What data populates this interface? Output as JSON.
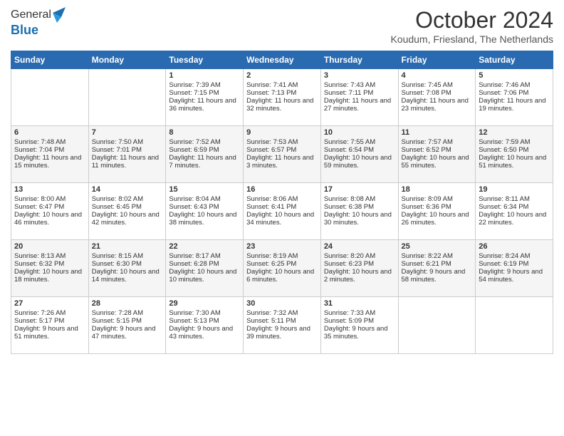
{
  "logo": {
    "line1": "General",
    "line2": "Blue"
  },
  "header": {
    "month": "October 2024",
    "location": "Koudum, Friesland, The Netherlands"
  },
  "weekdays": [
    "Sunday",
    "Monday",
    "Tuesday",
    "Wednesday",
    "Thursday",
    "Friday",
    "Saturday"
  ],
  "weeks": [
    [
      {
        "day": "",
        "sunrise": "",
        "sunset": "",
        "daylight": ""
      },
      {
        "day": "",
        "sunrise": "",
        "sunset": "",
        "daylight": ""
      },
      {
        "day": "1",
        "sunrise": "Sunrise: 7:39 AM",
        "sunset": "Sunset: 7:15 PM",
        "daylight": "Daylight: 11 hours and 36 minutes."
      },
      {
        "day": "2",
        "sunrise": "Sunrise: 7:41 AM",
        "sunset": "Sunset: 7:13 PM",
        "daylight": "Daylight: 11 hours and 32 minutes."
      },
      {
        "day": "3",
        "sunrise": "Sunrise: 7:43 AM",
        "sunset": "Sunset: 7:11 PM",
        "daylight": "Daylight: 11 hours and 27 minutes."
      },
      {
        "day": "4",
        "sunrise": "Sunrise: 7:45 AM",
        "sunset": "Sunset: 7:08 PM",
        "daylight": "Daylight: 11 hours and 23 minutes."
      },
      {
        "day": "5",
        "sunrise": "Sunrise: 7:46 AM",
        "sunset": "Sunset: 7:06 PM",
        "daylight": "Daylight: 11 hours and 19 minutes."
      }
    ],
    [
      {
        "day": "6",
        "sunrise": "Sunrise: 7:48 AM",
        "sunset": "Sunset: 7:04 PM",
        "daylight": "Daylight: 11 hours and 15 minutes."
      },
      {
        "day": "7",
        "sunrise": "Sunrise: 7:50 AM",
        "sunset": "Sunset: 7:01 PM",
        "daylight": "Daylight: 11 hours and 11 minutes."
      },
      {
        "day": "8",
        "sunrise": "Sunrise: 7:52 AM",
        "sunset": "Sunset: 6:59 PM",
        "daylight": "Daylight: 11 hours and 7 minutes."
      },
      {
        "day": "9",
        "sunrise": "Sunrise: 7:53 AM",
        "sunset": "Sunset: 6:57 PM",
        "daylight": "Daylight: 11 hours and 3 minutes."
      },
      {
        "day": "10",
        "sunrise": "Sunrise: 7:55 AM",
        "sunset": "Sunset: 6:54 PM",
        "daylight": "Daylight: 10 hours and 59 minutes."
      },
      {
        "day": "11",
        "sunrise": "Sunrise: 7:57 AM",
        "sunset": "Sunset: 6:52 PM",
        "daylight": "Daylight: 10 hours and 55 minutes."
      },
      {
        "day": "12",
        "sunrise": "Sunrise: 7:59 AM",
        "sunset": "Sunset: 6:50 PM",
        "daylight": "Daylight: 10 hours and 51 minutes."
      }
    ],
    [
      {
        "day": "13",
        "sunrise": "Sunrise: 8:00 AM",
        "sunset": "Sunset: 6:47 PM",
        "daylight": "Daylight: 10 hours and 46 minutes."
      },
      {
        "day": "14",
        "sunrise": "Sunrise: 8:02 AM",
        "sunset": "Sunset: 6:45 PM",
        "daylight": "Daylight: 10 hours and 42 minutes."
      },
      {
        "day": "15",
        "sunrise": "Sunrise: 8:04 AM",
        "sunset": "Sunset: 6:43 PM",
        "daylight": "Daylight: 10 hours and 38 minutes."
      },
      {
        "day": "16",
        "sunrise": "Sunrise: 8:06 AM",
        "sunset": "Sunset: 6:41 PM",
        "daylight": "Daylight: 10 hours and 34 minutes."
      },
      {
        "day": "17",
        "sunrise": "Sunrise: 8:08 AM",
        "sunset": "Sunset: 6:38 PM",
        "daylight": "Daylight: 10 hours and 30 minutes."
      },
      {
        "day": "18",
        "sunrise": "Sunrise: 8:09 AM",
        "sunset": "Sunset: 6:36 PM",
        "daylight": "Daylight: 10 hours and 26 minutes."
      },
      {
        "day": "19",
        "sunrise": "Sunrise: 8:11 AM",
        "sunset": "Sunset: 6:34 PM",
        "daylight": "Daylight: 10 hours and 22 minutes."
      }
    ],
    [
      {
        "day": "20",
        "sunrise": "Sunrise: 8:13 AM",
        "sunset": "Sunset: 6:32 PM",
        "daylight": "Daylight: 10 hours and 18 minutes."
      },
      {
        "day": "21",
        "sunrise": "Sunrise: 8:15 AM",
        "sunset": "Sunset: 6:30 PM",
        "daylight": "Daylight: 10 hours and 14 minutes."
      },
      {
        "day": "22",
        "sunrise": "Sunrise: 8:17 AM",
        "sunset": "Sunset: 6:28 PM",
        "daylight": "Daylight: 10 hours and 10 minutes."
      },
      {
        "day": "23",
        "sunrise": "Sunrise: 8:19 AM",
        "sunset": "Sunset: 6:25 PM",
        "daylight": "Daylight: 10 hours and 6 minutes."
      },
      {
        "day": "24",
        "sunrise": "Sunrise: 8:20 AM",
        "sunset": "Sunset: 6:23 PM",
        "daylight": "Daylight: 10 hours and 2 minutes."
      },
      {
        "day": "25",
        "sunrise": "Sunrise: 8:22 AM",
        "sunset": "Sunset: 6:21 PM",
        "daylight": "Daylight: 9 hours and 58 minutes."
      },
      {
        "day": "26",
        "sunrise": "Sunrise: 8:24 AM",
        "sunset": "Sunset: 6:19 PM",
        "daylight": "Daylight: 9 hours and 54 minutes."
      }
    ],
    [
      {
        "day": "27",
        "sunrise": "Sunrise: 7:26 AM",
        "sunset": "Sunset: 5:17 PM",
        "daylight": "Daylight: 9 hours and 51 minutes."
      },
      {
        "day": "28",
        "sunrise": "Sunrise: 7:28 AM",
        "sunset": "Sunset: 5:15 PM",
        "daylight": "Daylight: 9 hours and 47 minutes."
      },
      {
        "day": "29",
        "sunrise": "Sunrise: 7:30 AM",
        "sunset": "Sunset: 5:13 PM",
        "daylight": "Daylight: 9 hours and 43 minutes."
      },
      {
        "day": "30",
        "sunrise": "Sunrise: 7:32 AM",
        "sunset": "Sunset: 5:11 PM",
        "daylight": "Daylight: 9 hours and 39 minutes."
      },
      {
        "day": "31",
        "sunrise": "Sunrise: 7:33 AM",
        "sunset": "Sunset: 5:09 PM",
        "daylight": "Daylight: 9 hours and 35 minutes."
      },
      {
        "day": "",
        "sunrise": "",
        "sunset": "",
        "daylight": ""
      },
      {
        "day": "",
        "sunrise": "",
        "sunset": "",
        "daylight": ""
      }
    ]
  ]
}
